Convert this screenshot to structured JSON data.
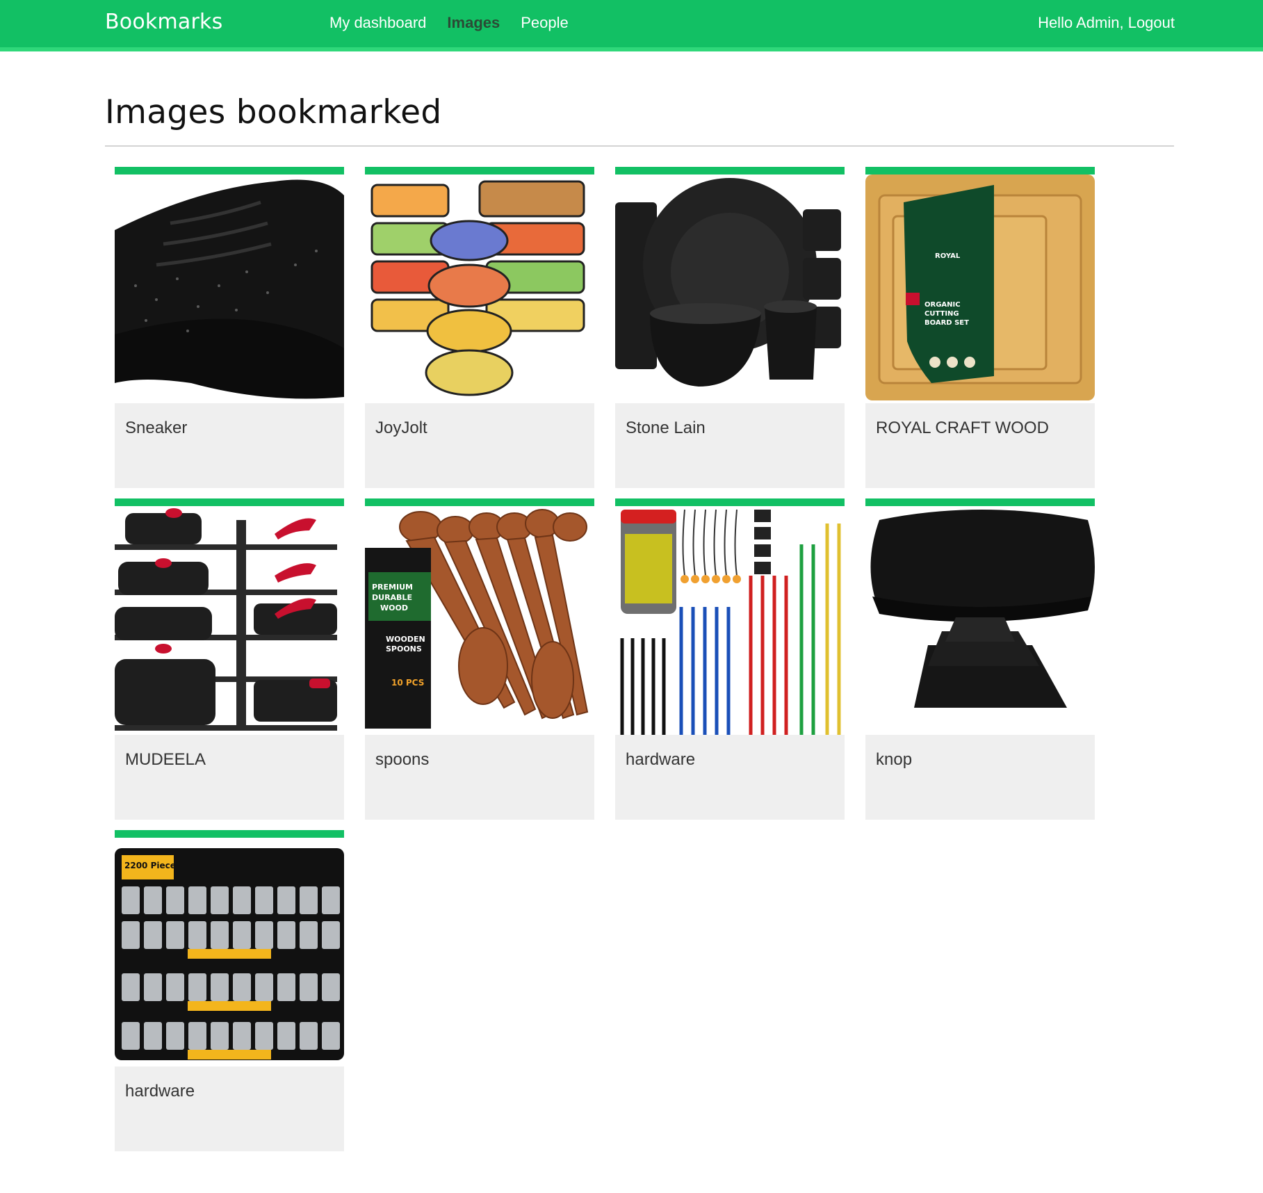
{
  "header": {
    "logo": "Bookmarks",
    "menu": [
      {
        "label": "My dashboard",
        "selected": false
      },
      {
        "label": "Images",
        "selected": true
      },
      {
        "label": "People",
        "selected": false
      }
    ],
    "greeting": "Hello Admin,",
    "logout": "Logout"
  },
  "page": {
    "title": "Images bookmarked"
  },
  "images": [
    {
      "title": "Sneaker",
      "thumbnail": "black-sneaker"
    },
    {
      "title": "JoyJolt",
      "thumbnail": "glass-food-containers"
    },
    {
      "title": "Stone Lain",
      "thumbnail": "black-dinnerware-set"
    },
    {
      "title": "ROYAL CRAFT WOOD",
      "thumbnail": "bamboo-cutting-boards"
    },
    {
      "title": "MUDEELA",
      "thumbnail": "pan-organizer-rack"
    },
    {
      "title": "spoons",
      "thumbnail": "wooden-spoons"
    },
    {
      "title": "hardware",
      "thumbnail": "bungee-cords"
    },
    {
      "title": "knop",
      "thumbnail": "black-cabinet-knob"
    },
    {
      "title": "hardware",
      "thumbnail": "bolt-screw-assortment"
    }
  ],
  "colors": {
    "brand": "#12c064",
    "card_bg": "#efefef"
  }
}
